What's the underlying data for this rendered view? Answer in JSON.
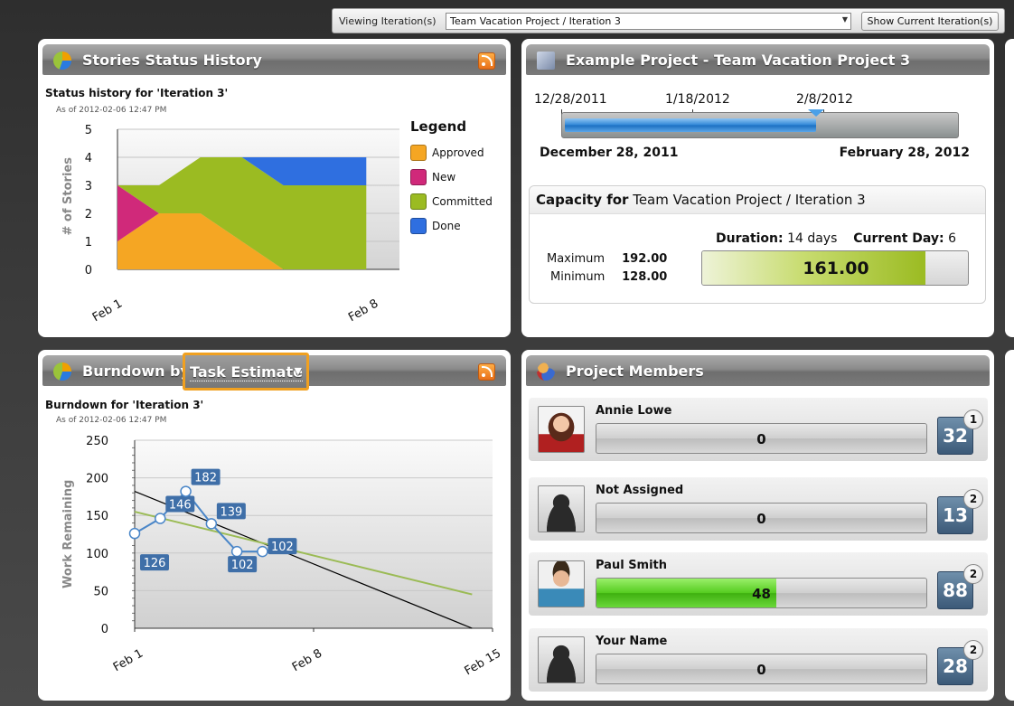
{
  "topbar": {
    "label": "Viewing Iteration(s)",
    "selected_iteration": "Team Vacation Project / Iteration 3",
    "show_current_button": "Show Current Iteration(s)"
  },
  "stories_panel": {
    "title": "Stories Status History",
    "chart_title": "Status history for 'Iteration 3'",
    "as_of": "As of 2012-02-06 12:47 PM",
    "legend_title": "Legend"
  },
  "burndown_panel": {
    "title_prefix": "Burndown by",
    "dropdown_value": "Task Estimate",
    "chart_title": "Burndown for 'Iteration 3'",
    "as_of": "As of 2012-02-06 12:47 PM"
  },
  "project_panel": {
    "title": "Example Project - Team Vacation Project 3",
    "tick_dates": [
      "12/28/2011",
      "1/18/2012",
      "2/8/2012"
    ],
    "start_date": "December 28, 2011",
    "end_date": "February 28, 2012",
    "timeline_progress_fraction": 0.64,
    "capacity_label": "Capacity for",
    "capacity_iteration": "Team Vacation Project / Iteration 3",
    "maximum_label": "Maximum",
    "maximum_value": "192.00",
    "minimum_label": "Minimum",
    "minimum_value": "128.00",
    "duration_label": "Duration:",
    "duration_value": "14 days",
    "current_day_label": "Current Day:",
    "current_day_value": "6",
    "capacity_value": "161.00",
    "capacity_fill_fraction": 0.84
  },
  "members_panel": {
    "title": "Project Members",
    "members": [
      {
        "name": "Annie Lowe",
        "bar_value": "0",
        "fill_fraction": 0,
        "count": "32",
        "badge": "1"
      },
      {
        "name": "Not Assigned",
        "bar_value": "0",
        "fill_fraction": 0,
        "count": "13",
        "badge": "2"
      },
      {
        "name": "Paul Smith",
        "bar_value": "48",
        "fill_fraction": 0.545,
        "count": "88",
        "badge": "2"
      },
      {
        "name": "Your Name",
        "bar_value": "0",
        "fill_fraction": 0,
        "count": "28",
        "badge": "2"
      }
    ]
  },
  "chart_data": [
    {
      "type": "area",
      "title": "Status history for 'Iteration 3'",
      "xlabel": "",
      "ylabel": "# of Stories",
      "x_tick_labels": [
        "Feb 1",
        "Feb 8"
      ],
      "x": [
        0,
        1,
        2,
        3,
        4,
        5,
        6
      ],
      "ylim": [
        0,
        5
      ],
      "yticks": [
        0,
        1,
        2,
        3,
        4,
        5
      ],
      "stacked": true,
      "series": [
        {
          "name": "Approved",
          "color": "#f5a623",
          "values": [
            1,
            2,
            2,
            1,
            0,
            0,
            0
          ]
        },
        {
          "name": "New",
          "color": "#d0297a",
          "values": [
            2,
            0,
            0,
            0,
            0,
            0,
            0
          ]
        },
        {
          "name": "Committed",
          "color": "#9bbb22",
          "values": [
            0,
            1,
            2,
            3,
            3,
            3,
            3
          ]
        },
        {
          "name": "Done",
          "color": "#2f6fe0",
          "values": [
            0,
            0,
            0,
            0,
            1,
            1,
            1
          ]
        }
      ],
      "grid": true,
      "legend": "right"
    },
    {
      "type": "line",
      "title": "Burndown for 'Iteration 3'",
      "xlabel": "",
      "ylabel": "Work Remaining",
      "x_tick_labels": [
        "Feb 1",
        "Feb 8",
        "Feb 15"
      ],
      "xlim": [
        0,
        14
      ],
      "ylim": [
        0,
        250
      ],
      "yticks": [
        0,
        50,
        100,
        150,
        200,
        250
      ],
      "series": [
        {
          "name": "",
          "kind": "actual",
          "color": "#4a86c8",
          "x": [
            0,
            1,
            2,
            3,
            4,
            5
          ],
          "values": [
            126,
            146,
            182,
            139,
            102,
            102
          ],
          "labels": [
            "126",
            "146",
            "182",
            "139",
            "102",
            "102"
          ]
        },
        {
          "name": "",
          "kind": "ideal",
          "color": "#000000",
          "x": [
            0,
            13.2
          ],
          "values": [
            182,
            0
          ]
        },
        {
          "name": "",
          "kind": "trend",
          "color": "#9bbb55",
          "x": [
            0,
            13.2
          ],
          "values": [
            155,
            45
          ]
        }
      ],
      "grid": true
    }
  ]
}
